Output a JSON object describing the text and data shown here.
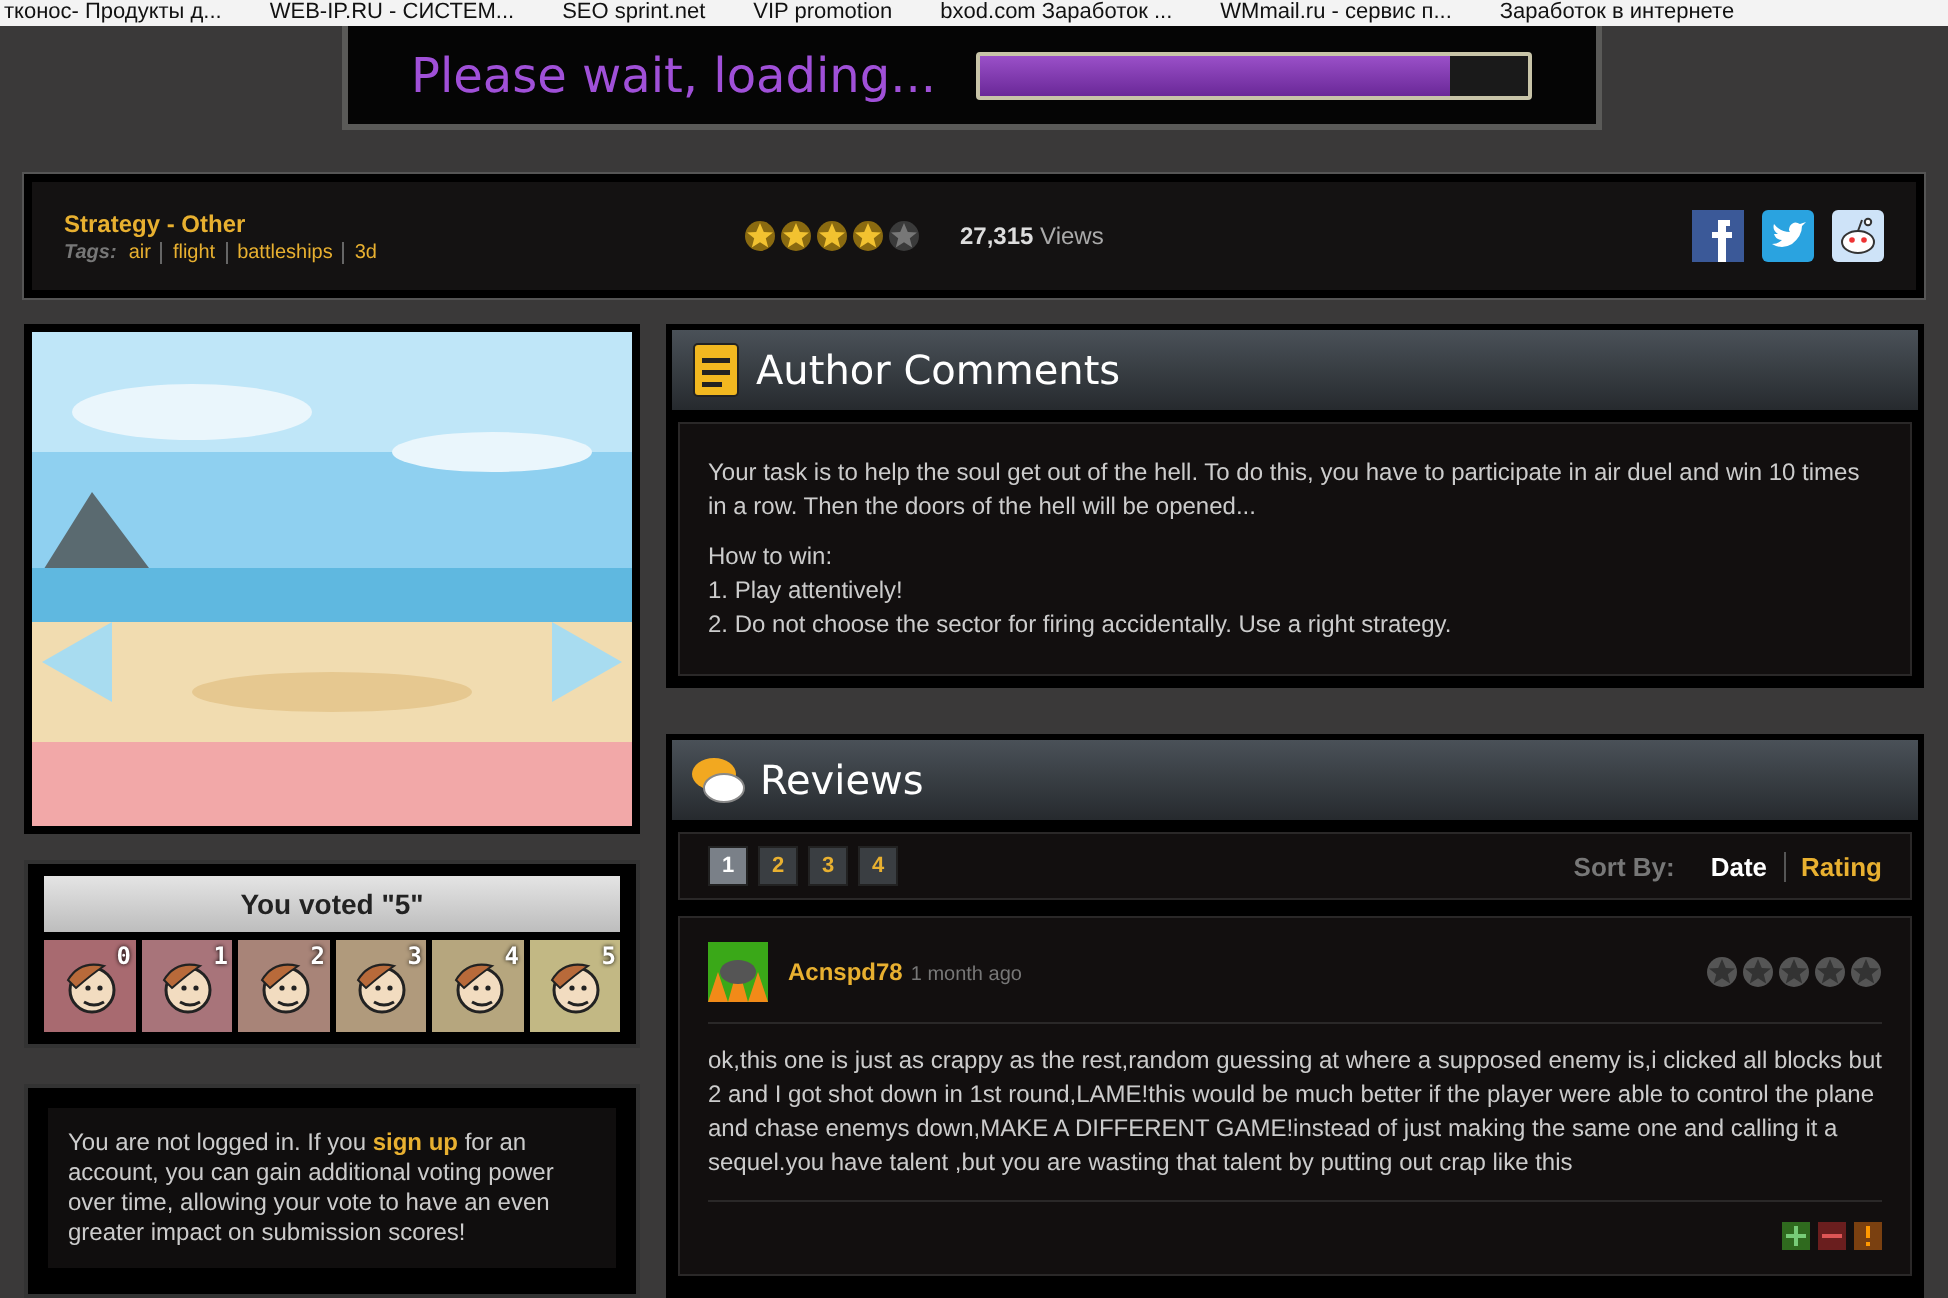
{
  "bookmarks": [
    "тконос- Продукты д...",
    "WEB-IP.RU - СИСТЕМ...",
    "SEO sprint.net",
    "VIP promotion",
    "bxod.com Заработок ...",
    "WMmail.ru - сервис п...",
    "Заработок в интернете"
  ],
  "loader": {
    "text": "Please wait, loading...",
    "level": 0.86
  },
  "info": {
    "genre": "Strategy - Other",
    "tags_label": "Tags:",
    "tags": [
      "air",
      "flight",
      "battleships",
      "3d"
    ],
    "stars": 4,
    "views_count": "27,315",
    "views_label": "Views"
  },
  "vote": {
    "title": "You voted \"5\"",
    "faces": [
      {
        "label": "0"
      },
      {
        "label": "1"
      },
      {
        "label": "2"
      },
      {
        "label": "3"
      },
      {
        "label": "4"
      },
      {
        "label": "5"
      }
    ]
  },
  "login_notice": {
    "before": "You are not logged in. If you",
    "link": "sign up",
    "after": "for an account, you can gain additional voting power over time, allowing your vote to have an even greater impact on submission scores!"
  },
  "author_comments": {
    "title": "Author Comments",
    "paragraphs": [
      [
        "Your task is to help the soul get out of the hell. To do this, you have to participate in air duel and win 10 times in a row. Then the doors of the hell will be opened..."
      ],
      [
        "How to win:",
        "1. Play attentively!",
        "2. Do not choose the sector for firing accidentally. Use a right strategy."
      ]
    ]
  },
  "reviews": {
    "title": "Reviews",
    "pages": [
      {
        "label": "1",
        "selected": true
      },
      {
        "label": "2",
        "selected": false
      },
      {
        "label": "3",
        "selected": false
      },
      {
        "label": "4",
        "selected": false
      }
    ],
    "sort_label": "Sort By:",
    "sort_options": [
      {
        "label": "Date",
        "selected": true
      },
      {
        "label": "Rating",
        "selected": false
      }
    ],
    "items": [
      {
        "author": "Acnspd78",
        "time": "1 month ago",
        "stars": 0,
        "text": "ok,this one is just as crappy as the rest,random guessing at where a supposed enemy is,i clicked all blocks but 2 and I got shot down in 1st round,LAME!this would be much better if the player were able to control the plane and chase enemys down,MAKE A DIFFERENT GAME!instead of just making the same one and calling it a sequel.you have talent ,but you are wasting that talent by putting out crap like this"
      }
    ]
  }
}
